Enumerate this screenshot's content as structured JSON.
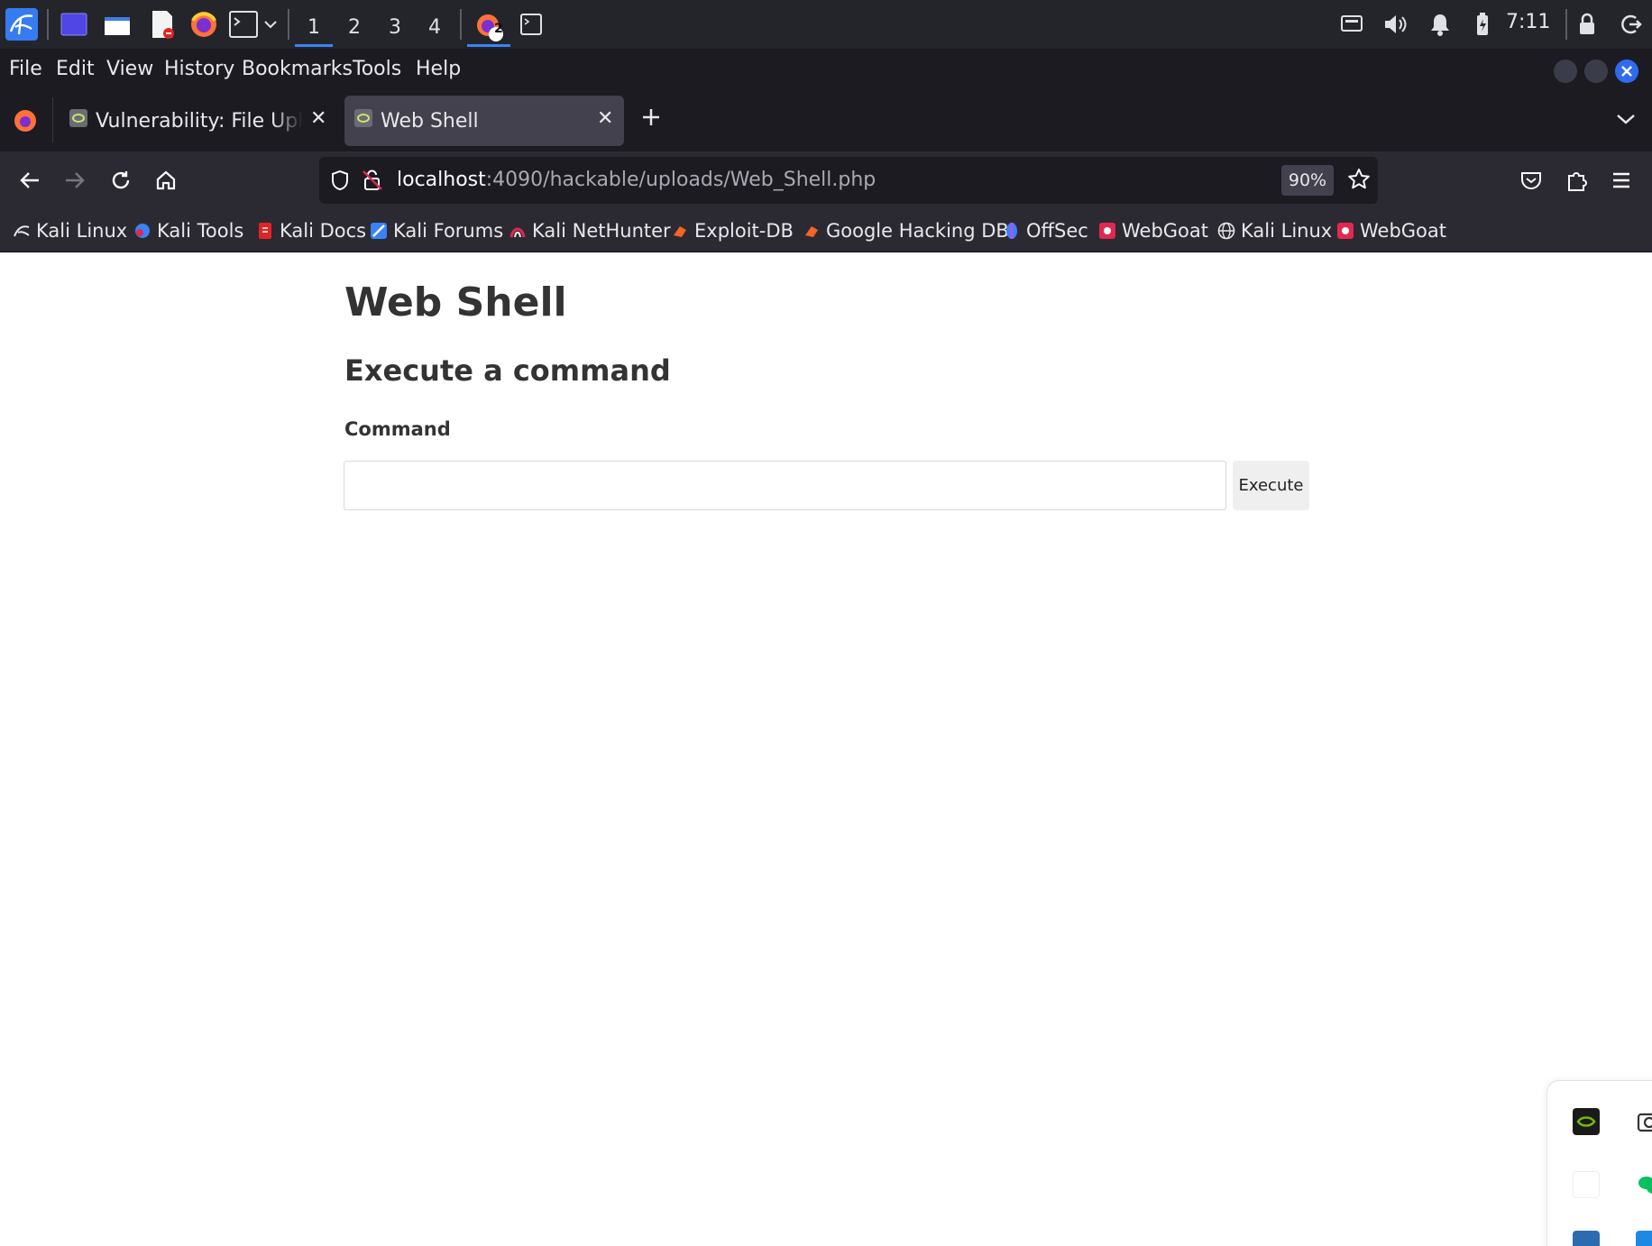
{
  "taskbar": {
    "workspaces": [
      "1",
      "2",
      "3",
      "4"
    ],
    "active_workspace": "1",
    "firefox_badge": "2",
    "time": "7:11"
  },
  "menubar": {
    "items": [
      "File",
      "Edit",
      "View",
      "History",
      "Bookmarks",
      "Tools",
      "Help"
    ]
  },
  "tabs": [
    {
      "label": "Vulnerability: File Upload",
      "active": false
    },
    {
      "label": "Web Shell",
      "active": true
    }
  ],
  "navbar": {
    "url_host": "localhost",
    "url_rest": ":4090/hackable/uploads/Web_Shell.php",
    "zoom": "90%"
  },
  "bookmarks": [
    {
      "label": "Kali Linux",
      "icon": "kali-dragon-icon"
    },
    {
      "label": "Kali Tools",
      "icon": "kali-tools-icon"
    },
    {
      "label": "Kali Docs",
      "icon": "kali-docs-icon"
    },
    {
      "label": "Kali Forums",
      "icon": "kali-forums-icon"
    },
    {
      "label": "Kali NetHunter",
      "icon": "nethunter-icon"
    },
    {
      "label": "Exploit-DB",
      "icon": "exploit-db-icon"
    },
    {
      "label": "Google Hacking DB",
      "icon": "ghdb-icon"
    },
    {
      "label": "OffSec",
      "icon": "offsec-icon"
    },
    {
      "label": "WebGoat",
      "icon": "webgoat-icon"
    },
    {
      "label": "Kali Linux",
      "icon": "globe-icon"
    },
    {
      "label": "WebGoat",
      "icon": "webgoat-icon"
    }
  ],
  "page": {
    "title": "Web Shell",
    "subtitle": "Execute a command",
    "command_label": "Command",
    "command_value": "",
    "execute_label": "Execute"
  },
  "colors": {
    "accent": "#3b82f6",
    "taskbar_bg": "#23252b",
    "toolbar_bg": "#2b2a33",
    "tabbar_bg": "#1c1b22"
  }
}
